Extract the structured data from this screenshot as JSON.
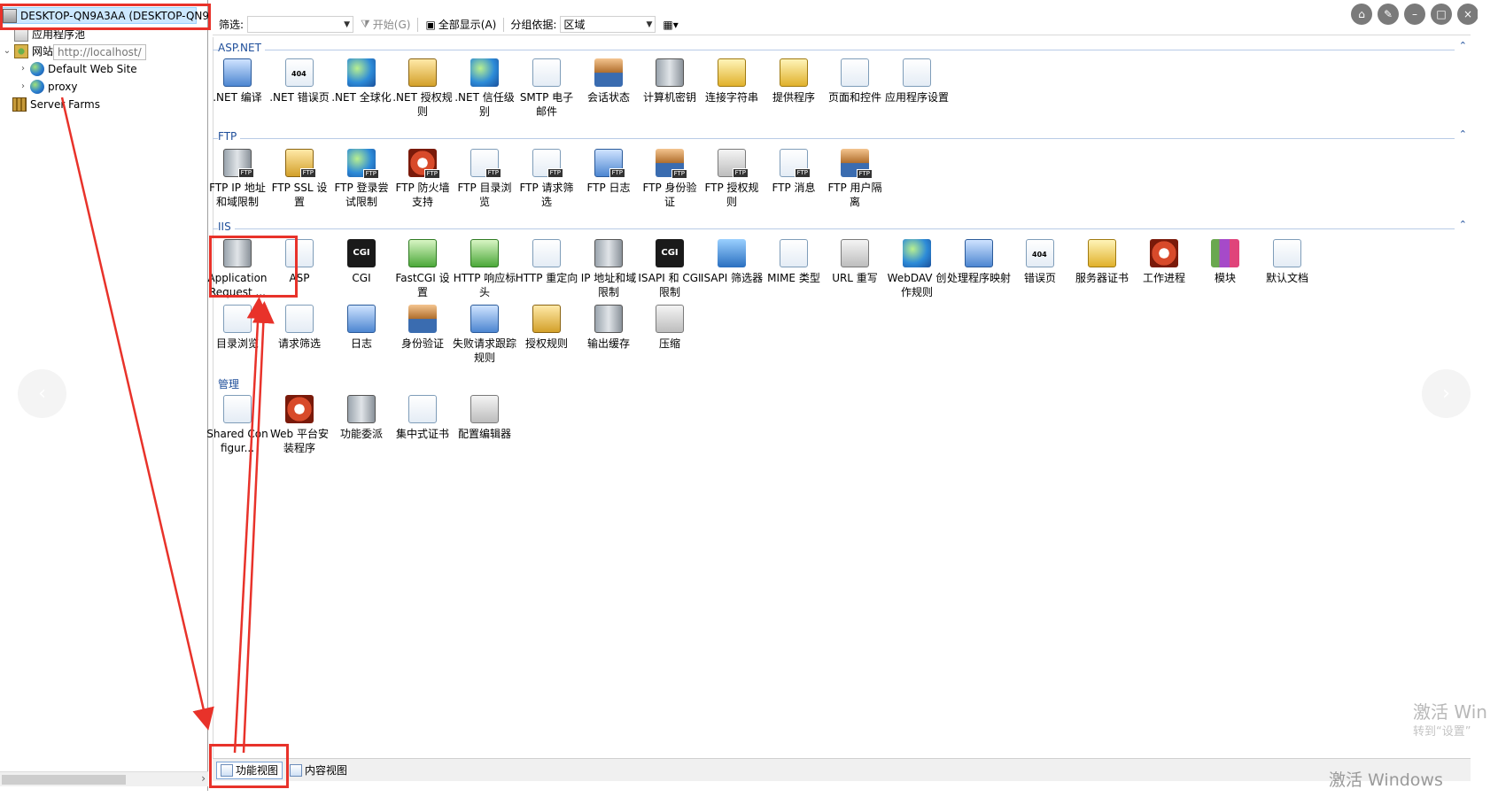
{
  "tree": {
    "server": "DESKTOP-QN9A3AA (DESKTOP-QN9",
    "app_pools": "应用程序池",
    "sites": "网站",
    "site_tooltip": "http://localhost/",
    "default_site": "Default Web Site",
    "proxy": "proxy",
    "server_farms": "Server Farms"
  },
  "toolbar": {
    "filter_label": "筛选:",
    "filter_value": "",
    "start_label": "开始(G)",
    "show_all_label": "全部显示(A)",
    "group_by_label": "分组依据:",
    "group_by_value": "区域"
  },
  "groups": {
    "aspnet": {
      "name": "ASP.NET",
      "items": [
        {
          "label": ".NET 编译",
          "icon": "net-compile-icon"
        },
        {
          "label": ".NET 错误页",
          "icon": "net-error-page-icon"
        },
        {
          "label": ".NET 全球化",
          "icon": "net-globalization-icon"
        },
        {
          "label": ".NET 授权规则",
          "icon": "net-authorization-icon"
        },
        {
          "label": ".NET 信任级别",
          "icon": "net-trust-level-icon"
        },
        {
          "label": "SMTP 电子邮件",
          "icon": "smtp-email-icon"
        },
        {
          "label": "会话状态",
          "icon": "session-state-icon"
        },
        {
          "label": "计算机密钥",
          "icon": "machine-key-icon"
        },
        {
          "label": "连接字符串",
          "icon": "connection-strings-icon"
        },
        {
          "label": "提供程序",
          "icon": "providers-icon"
        },
        {
          "label": "页面和控件",
          "icon": "pages-controls-icon"
        },
        {
          "label": "应用程序设置",
          "icon": "app-settings-icon"
        }
      ]
    },
    "ftp": {
      "name": "FTP",
      "items": [
        {
          "label": "FTP IP 地址和域限制",
          "icon": "ftp-ip-icon"
        },
        {
          "label": "FTP SSL 设置",
          "icon": "ftp-ssl-icon"
        },
        {
          "label": "FTP 登录尝试限制",
          "icon": "ftp-logon-icon"
        },
        {
          "label": "FTP 防火墙支持",
          "icon": "ftp-firewall-icon"
        },
        {
          "label": "FTP 目录浏览",
          "icon": "ftp-directory-browse-icon"
        },
        {
          "label": "FTP 请求筛选",
          "icon": "ftp-request-filter-icon"
        },
        {
          "label": "FTP 日志",
          "icon": "ftp-logging-icon"
        },
        {
          "label": "FTP 身份验证",
          "icon": "ftp-authentication-icon"
        },
        {
          "label": "FTP 授权规则",
          "icon": "ftp-authorization-icon"
        },
        {
          "label": "FTP 消息",
          "icon": "ftp-messages-icon"
        },
        {
          "label": "FTP 用户隔离",
          "icon": "ftp-user-isolation-icon"
        }
      ]
    },
    "iis": {
      "name": "IIS",
      "items": [
        {
          "label": "Application Request ...",
          "icon": "arr-icon"
        },
        {
          "label": "ASP",
          "icon": "asp-icon"
        },
        {
          "label": "CGI",
          "icon": "cgi-icon"
        },
        {
          "label": "FastCGI 设置",
          "icon": "fastcgi-icon"
        },
        {
          "label": "HTTP 响应标头",
          "icon": "http-headers-icon"
        },
        {
          "label": "HTTP 重定向",
          "icon": "http-redirect-icon"
        },
        {
          "label": "IP 地址和域限制",
          "icon": "ip-restrictions-icon"
        },
        {
          "label": "ISAPI 和 CGI 限制",
          "icon": "isapi-cgi-icon"
        },
        {
          "label": "ISAPI 筛选器",
          "icon": "isapi-filters-icon"
        },
        {
          "label": "MIME 类型",
          "icon": "mime-types-icon"
        },
        {
          "label": "URL 重写",
          "icon": "url-rewrite-icon"
        },
        {
          "label": "WebDAV 创作规则",
          "icon": "webdav-icon"
        },
        {
          "label": "处理程序映射",
          "icon": "handler-mappings-icon"
        },
        {
          "label": "错误页",
          "icon": "error-pages-icon"
        },
        {
          "label": "服务器证书",
          "icon": "server-certificates-icon"
        },
        {
          "label": "工作进程",
          "icon": "worker-processes-icon"
        },
        {
          "label": "模块",
          "icon": "modules-icon"
        },
        {
          "label": "默认文档",
          "icon": "default-document-icon"
        },
        {
          "label": "目录浏览",
          "icon": "directory-browsing-icon"
        },
        {
          "label": "请求筛选",
          "icon": "request-filtering-icon"
        },
        {
          "label": "日志",
          "icon": "logging-icon"
        },
        {
          "label": "身份验证",
          "icon": "authentication-icon"
        },
        {
          "label": "失败请求跟踪规则",
          "icon": "failed-request-tracing-icon"
        },
        {
          "label": "授权规则",
          "icon": "authorization-rules-icon"
        },
        {
          "label": "输出缓存",
          "icon": "output-caching-icon"
        },
        {
          "label": "压缩",
          "icon": "compression-icon"
        }
      ]
    },
    "management": {
      "name": "管理",
      "items": [
        {
          "label": "Shared Configur...",
          "icon": "shared-config-icon"
        },
        {
          "label": "Web 平台安装程序",
          "icon": "web-platform-installer-icon"
        },
        {
          "label": "功能委派",
          "icon": "feature-delegation-icon"
        },
        {
          "label": "集中式证书",
          "icon": "centralized-certificates-icon"
        },
        {
          "label": "配置编辑器",
          "icon": "configuration-editor-icon"
        }
      ]
    }
  },
  "bottom_tabs": {
    "features_view": "功能视图",
    "content_view": "内容视图"
  },
  "watermark": {
    "line1": "激活 Win",
    "line2": "转到“设置”",
    "bottom": "激活 Windows"
  },
  "colors": {
    "accent": "#1e4e9a",
    "annotation": "#e8322a",
    "selection": "#cce8ff"
  }
}
